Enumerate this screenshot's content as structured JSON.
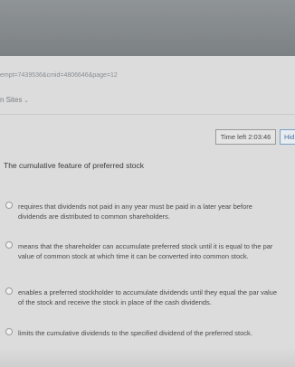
{
  "browser": {
    "url_fragment": "empt=7439536&cmid=4806646&page=12"
  },
  "nav": {
    "sites_label": "n Sites",
    "chevron_icon": "chevron-down-icon"
  },
  "quiz": {
    "time_left": "Time left 2:03:46",
    "hide_label": "Hid",
    "question": "The cumulative feature of preferred stock",
    "options": [
      {
        "text": "requires that dividends not paid in any year must be paid in a later year before dividends are distributed to common shareholders."
      },
      {
        "text": "means that the shareholder can accumulate preferred stock until it is equal to the par value of common stock at which time it can be converted into common stock."
      },
      {
        "text": "enables a preferred stockholder to accumulate dividends until they equal the par value of the stock and receive the stock in place of the cash dividends."
      },
      {
        "text": "limits the cumulative dividends to the specified dividend of the preferred stock."
      }
    ]
  }
}
